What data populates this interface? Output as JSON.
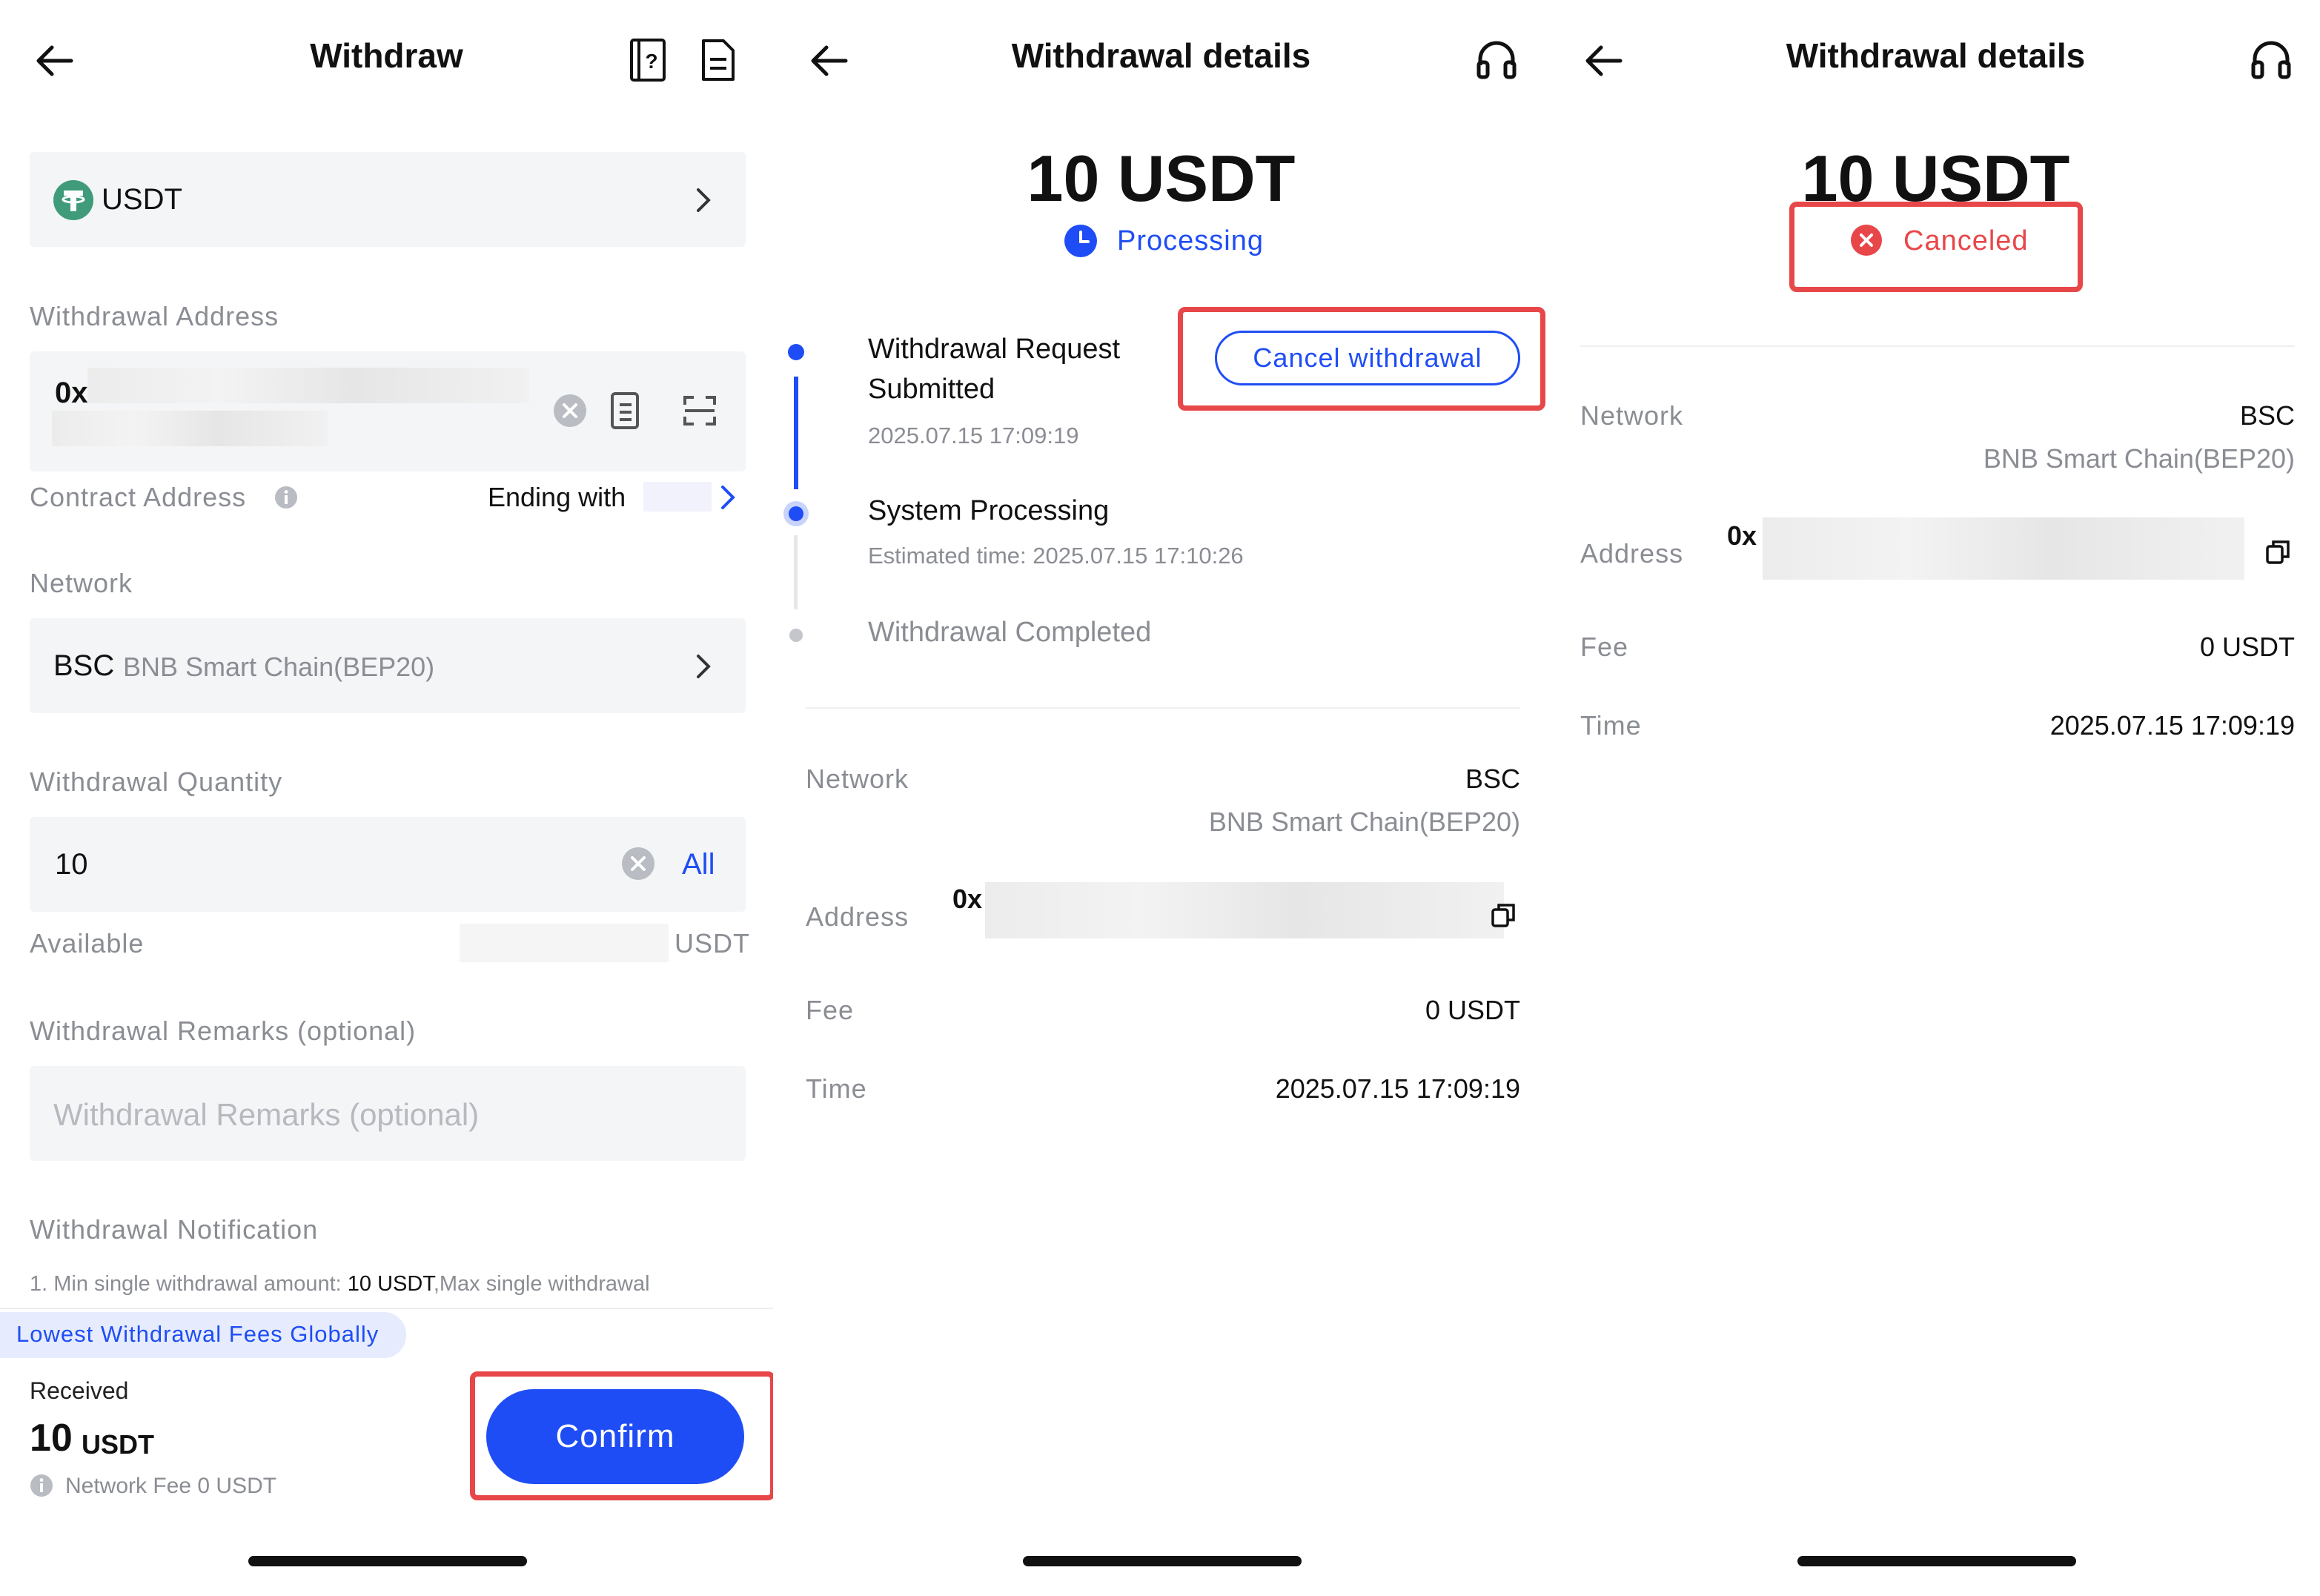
{
  "panel1": {
    "title": "Withdraw",
    "coin": "USDT",
    "withdrawal_address_label": "Withdrawal Address",
    "address_prefix": "0x",
    "contract_address_label": "Contract Address",
    "contract_ending": "Ending with",
    "network_label": "Network",
    "network_code": "BSC",
    "network_name": "BNB Smart Chain(BEP20)",
    "quantity_label": "Withdrawal Quantity",
    "quantity_value": "10",
    "all_label": "All",
    "available_label": "Available",
    "available_unit": "USDT",
    "remarks_label": "Withdrawal Remarks (optional)",
    "remarks_placeholder": "Withdrawal Remarks (optional)",
    "notification_label": "Withdrawal Notification",
    "notification_text_pre": "1. Min single withdrawal amount: ",
    "notification_text_bold": "10 USDT",
    "notification_text_post": ",Max single withdrawal",
    "promo": "Lowest Withdrawal Fees Globally",
    "received_label": "Received",
    "received_amount": "10",
    "received_unit": "USDT",
    "network_fee": "Network Fee 0 USDT",
    "confirm_label": "Confirm"
  },
  "panel2": {
    "title": "Withdrawal details",
    "amount": "10 USDT",
    "status": "Processing",
    "step1_title_line1": "Withdrawal Request",
    "step1_title_line2": "Submitted",
    "step1_time": "2025.07.15 17:09:19",
    "cancel_label": "Cancel withdrawal",
    "step2_title": "System Processing",
    "step2_time": "Estimated time: 2025.07.15 17:10:26",
    "step3_title": "Withdrawal Completed",
    "network_label": "Network",
    "network_code": "BSC",
    "network_name": "BNB Smart Chain(BEP20)",
    "address_label": "Address",
    "address_prefix": "0x",
    "fee_label": "Fee",
    "fee_value": "0 USDT",
    "time_label": "Time",
    "time_value": "2025.07.15 17:09:19"
  },
  "panel3": {
    "title": "Withdrawal details",
    "amount": "10 USDT",
    "status": "Canceled",
    "network_label": "Network",
    "network_code": "BSC",
    "network_name": "BNB Smart Chain(BEP20)",
    "address_label": "Address",
    "address_prefix": "0x",
    "fee_label": "Fee",
    "fee_value": "0 USDT",
    "time_label": "Time",
    "time_value": "2025.07.15 17:09:19"
  },
  "colors": {
    "accent": "#1f4df5",
    "highlight_red": "#e8474a",
    "tether_green": "#3f9b7a",
    "field_bg": "#f4f5f7",
    "muted_text": "#8a8d93"
  },
  "icons": [
    "back-arrow-icon",
    "help-doc-icon",
    "record-icon",
    "tether-icon",
    "chevron-right-icon",
    "clear-icon",
    "address-book-icon",
    "scan-icon",
    "info-icon",
    "clock-icon",
    "headset-icon",
    "copy-icon",
    "cancel-circle-icon"
  ]
}
